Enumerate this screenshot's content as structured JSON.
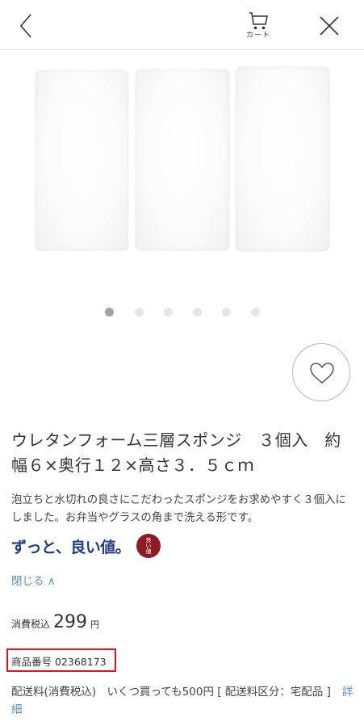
{
  "header": {
    "back_icon": "chevron-left-icon",
    "cart_icon": "cart-icon",
    "cart_label": "カート",
    "close_icon": "close-icon"
  },
  "gallery": {
    "total_images": 6,
    "active_index": 0
  },
  "favorite": {
    "icon": "heart-icon"
  },
  "product": {
    "title": "ウレタンフォーム三層スポンジ　３個入　約幅６×奥行１２×高さ３．５ｃｍ",
    "description": "泡立ちと水切れの良さにこだわったスポンジをお求めやすく３個入にしました。お弁当やグラスの角まで洗える形です。",
    "brand_text": "ずっと、良い値。",
    "brand_badge": [
      "良",
      "い",
      "値"
    ],
    "toggle_label": "閉じる ∧",
    "price_label": "消費税込",
    "price_value": "299",
    "price_unit": "円",
    "item_number": "商品番号 02368173",
    "shipping_text": "配送料(消費税込)　いくつ買っても500円 [ 配送料区分：宅配品 ]",
    "shipping_link": "詳細"
  },
  "colors": {
    "link": "#5b8fd0",
    "brand_blue": "#1f3d8a",
    "brand_badge": "#8e1a22",
    "highlight_border": "#e0141c"
  }
}
